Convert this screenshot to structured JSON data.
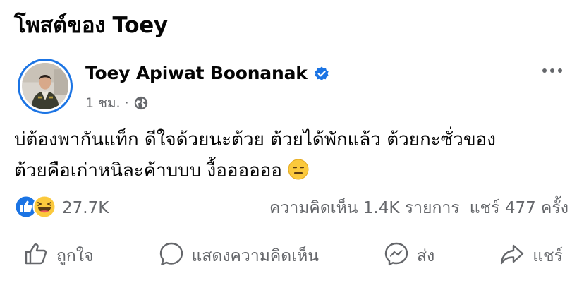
{
  "header": {
    "title": "โพสต์ของ Toey"
  },
  "post": {
    "author": "Toey Apiwat Boonanak",
    "verified_icon": "verified-badge-icon",
    "time": "1 ชม. ·",
    "privacy_icon": "globe-icon",
    "text_line1": "บ่ต้องพากันแท็ก ดีใจด้วยนะต้วย ต้วยได้พักแล้ว ต้วยกะซั่วของ",
    "text_line2": "ต้วยคือเก่าหนิละค้าบบบ งื้ออออออ",
    "emoji": "expressionless-face-emoji"
  },
  "reactions": {
    "icons": [
      "like-reaction-icon",
      "haha-reaction-icon"
    ],
    "count": "27.7K",
    "comments": "ความคิดเห็น 1.4K รายการ",
    "shares": "แชร์ 477 ครั้ง"
  },
  "actions": {
    "like": "ถูกใจ",
    "comment": "แสดงความคิดเห็น",
    "send": "ส่ง",
    "share": "แชร์"
  },
  "colors": {
    "accent": "#1b74e4",
    "secondary_text": "#65676b",
    "primary_text": "#050505"
  }
}
